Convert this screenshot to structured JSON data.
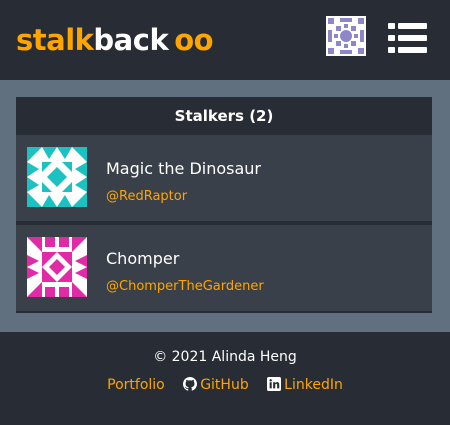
{
  "header": {
    "logo_part1": "stalk",
    "logo_part2": "back",
    "logo_symbol": "oo",
    "menu_icon": "hamburger-menu-icon",
    "avatar_icon": "identicon-avatar"
  },
  "stalkers": {
    "title": "Stalkers (2)",
    "items": [
      {
        "name": "Magic the Dinosaur",
        "handle": "@RedRaptor",
        "avatar_color": "#1cc2c2"
      },
      {
        "name": "Chomper",
        "handle": "@ChomperTheGardener",
        "avatar_color": "#e02aa6"
      }
    ]
  },
  "footer": {
    "copyright": "© 2021 Alinda Heng",
    "links": [
      {
        "label": "Portfolio",
        "icon": ""
      },
      {
        "label": "GitHub",
        "icon": "github-icon"
      },
      {
        "label": "LinkedIn",
        "icon": "linkedin-icon"
      }
    ]
  },
  "colors": {
    "accent": "#ffa500",
    "background": "#282c34",
    "panel_row": "#394049",
    "content_bg": "#61707f"
  }
}
